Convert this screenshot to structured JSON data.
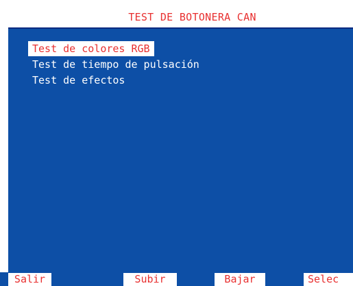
{
  "title": "TEST DE BOTONERA CAN",
  "menu": {
    "selected_index": 0,
    "items": [
      {
        "label": "Test de colores RGB"
      },
      {
        "label": "Test de tiempo de pulsación"
      },
      {
        "label": "Test de efectos"
      }
    ]
  },
  "softkeys": {
    "salir": "Salir",
    "subir": "Subir",
    "bajar": "Bajar",
    "selec": "Selec"
  },
  "colors": {
    "screen_bg": "#0d4fa6",
    "accent_red": "#e83030",
    "text_white": "#ffffff"
  }
}
